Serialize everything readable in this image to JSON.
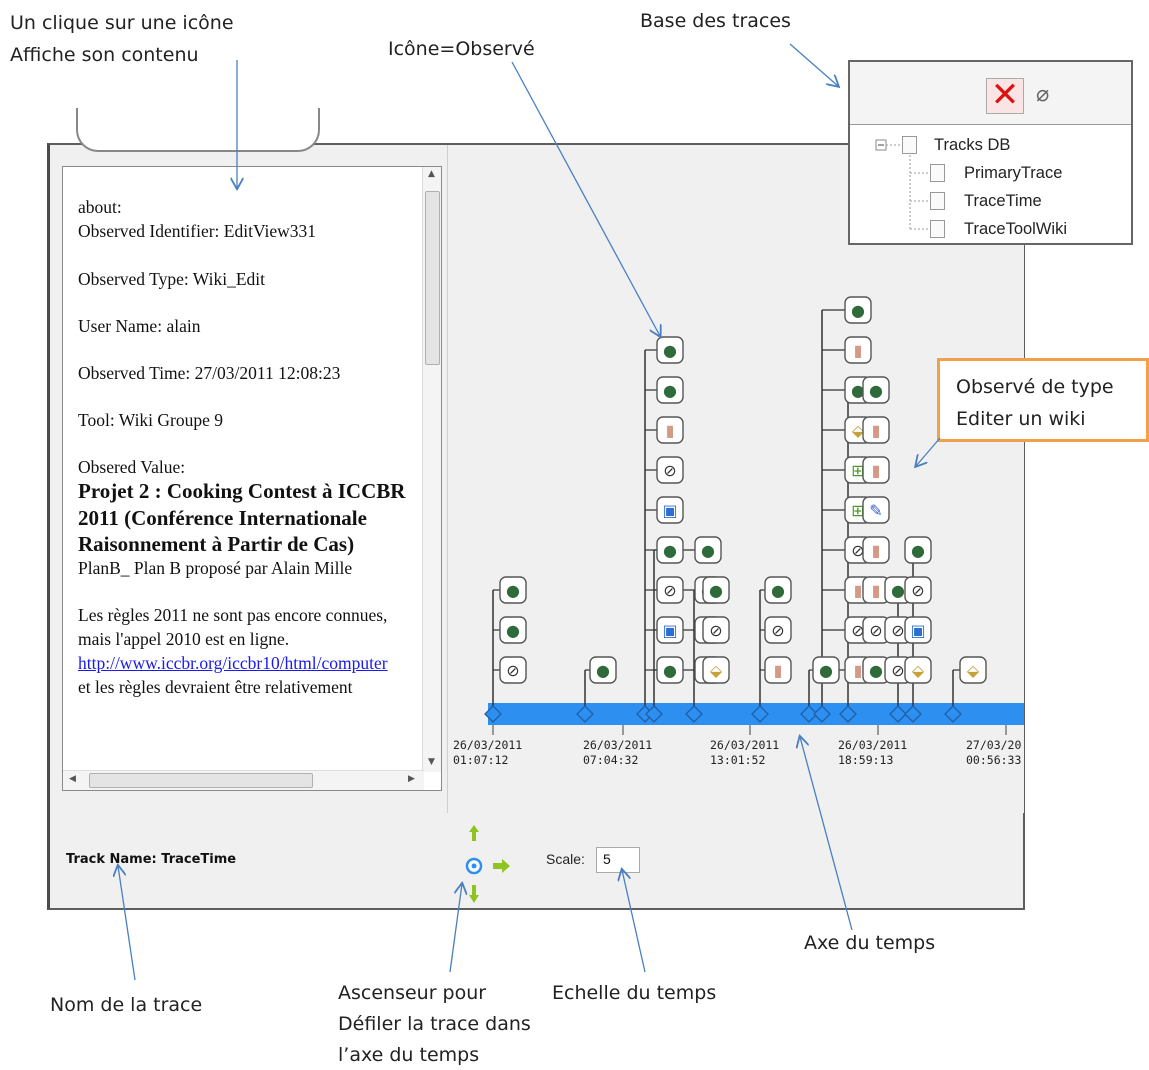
{
  "annotations": {
    "click_icon_line1": "Un clique sur une icône",
    "click_icon_line2": "Affiche son contenu",
    "icon_observed": "Icône=Observé",
    "trace_base": "Base des traces",
    "observed_type_line1": "Observé de type",
    "observed_type_line2": "Editer un wiki",
    "time_axis": "Axe du temps",
    "trace_name": "Nom de la trace",
    "scroller_line1": "Ascenseur pour",
    "scroller_line2": "Défiler la trace dans",
    "scroller_line3": "l’axe du temps",
    "time_scale": "Echelle du temps"
  },
  "details": {
    "about": "about:",
    "observed_identifier": "Observed Identifier: EditView331",
    "observed_type": "Observed Type: Wiki_Edit",
    "user_name": "User Name: alain",
    "observed_time": "Observed Time: 27/03/2011 12:08:23",
    "tool": "Tool: Wiki Groupe 9",
    "observed_value": "Obsered Value:",
    "title": "Projet 2 : Cooking Contest à ICCBR 2011 (Conférence Internationale Raisonnement à Partir de Cas)",
    "plan": "PlanB_ Plan B proposé par Alain Mille",
    "para_start": "Les règles 2011 ne sont pas encore connues, mais l'appel 2010 est en ligne.",
    "link": "http://www.iccbr.org/iccbr10/html/computer",
    "para_end": "et les règles devraient être relativement"
  },
  "tracks_db": {
    "root": "Tracks DB",
    "children": [
      "PrimaryTrace",
      "TraceTime",
      "TraceToolWiki"
    ]
  },
  "footer": {
    "track_name_label": "Track Name:",
    "track_name_value": "TraceTime",
    "scale_label": "Scale:",
    "scale_value": "5"
  },
  "timeline": {
    "ticks": [
      {
        "date": "26/03/2011",
        "time": "01:07:12"
      },
      {
        "date": "26/03/2011",
        "time": "07:04:32"
      },
      {
        "date": "26/03/2011",
        "time": "13:01:52"
      },
      {
        "date": "26/03/2011",
        "time": "18:59:13"
      },
      {
        "date": "27/03/20",
        "time": "00:56:33"
      }
    ],
    "colors": {
      "axis": "#2d8ff0",
      "marker_stroke": "#1f5fa8",
      "icon_border": "#555555"
    }
  }
}
